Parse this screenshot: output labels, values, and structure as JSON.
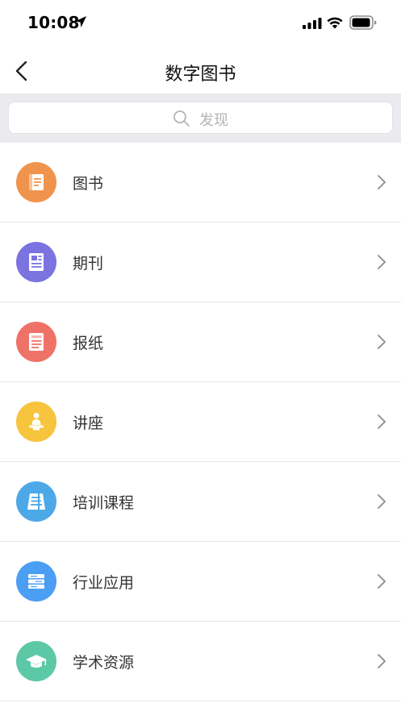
{
  "status": {
    "time": "10:08"
  },
  "nav": {
    "title": "数字图书"
  },
  "search": {
    "placeholder": "发现"
  },
  "items": [
    {
      "label": "图书",
      "color": "#f0944d",
      "icon": "book-icon"
    },
    {
      "label": "期刊",
      "color": "#7b73e0",
      "icon": "journal-icon"
    },
    {
      "label": "报纸",
      "color": "#ef7268",
      "icon": "newspaper-icon"
    },
    {
      "label": "讲座",
      "color": "#f6c43d",
      "icon": "lecture-icon"
    },
    {
      "label": "培训课程",
      "color": "#4da8e8",
      "icon": "training-icon"
    },
    {
      "label": "行业应用",
      "color": "#4a9ef4",
      "icon": "industry-icon"
    },
    {
      "label": "学术资源",
      "color": "#5cc8a6",
      "icon": "graduation-cap-icon"
    }
  ]
}
